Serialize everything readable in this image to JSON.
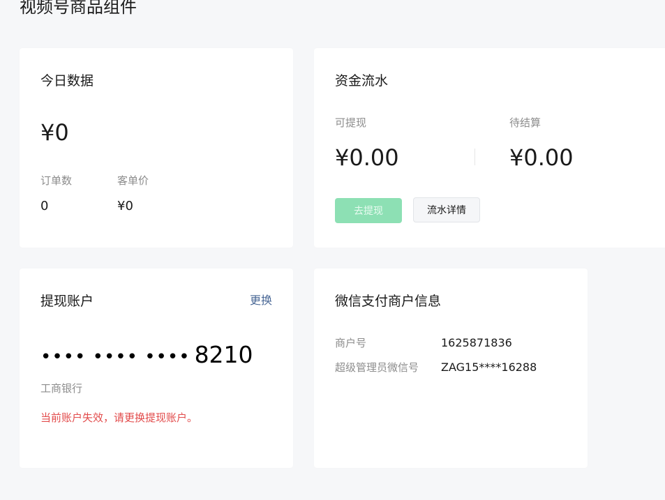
{
  "page": {
    "title": "视频号商品组件"
  },
  "today": {
    "title": "今日数据",
    "amount": "¥0",
    "orders_label": "订单数",
    "orders_value": "0",
    "avg_label": "客单价",
    "avg_value": "¥0"
  },
  "flow": {
    "title": "资金流水",
    "withdrawable_label": "可提现",
    "withdrawable_value": "¥0.00",
    "pending_label": "待结算",
    "pending_value": "¥0.00",
    "withdraw_button": "去提现",
    "detail_button": "流水详情"
  },
  "account": {
    "title": "提现账户",
    "change_link": "更换",
    "card_mask": "•••• •••• ••••",
    "card_last4": "8210",
    "bank": "工商银行",
    "warning": "当前账户失效，请更换提现账户。"
  },
  "merchant": {
    "title": "微信支付商户信息",
    "merchant_no_label": "商户号",
    "merchant_no_value": "1625871836",
    "admin_label": "超级管理员微信号",
    "admin_value": "ZAG15****16288"
  },
  "colors": {
    "accent": "#8de0b4",
    "warning": "#e24b4b",
    "link": "#4a6896",
    "background": "#f6f7f9"
  }
}
